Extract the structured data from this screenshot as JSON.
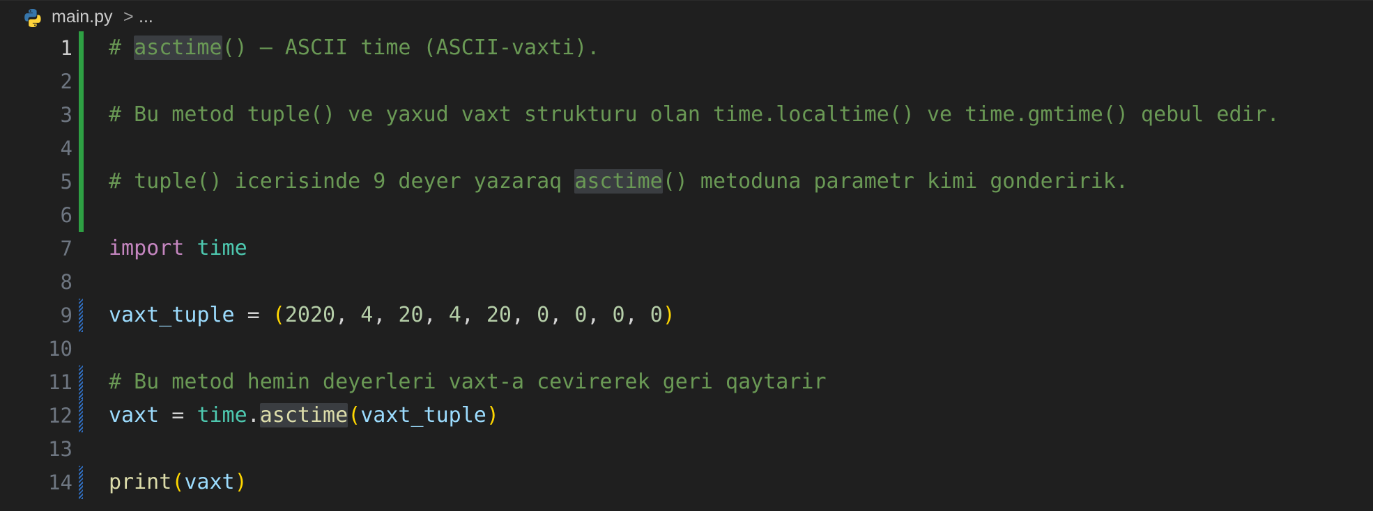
{
  "breadcrumb": {
    "file": "main.py",
    "separator": ">",
    "more": "..."
  },
  "icons": {
    "file_icon": "python-icon",
    "colors": {
      "python_blue": "#3776ab",
      "python_yellow": "#ffd43b"
    }
  },
  "gutter_colors": {
    "added": "#2ea043",
    "modified": "#2f6ec0"
  },
  "lines": [
    {
      "num": "1",
      "active": true,
      "tokens": [
        {
          "t": "# ",
          "c": "cmt"
        },
        {
          "t": "asctime",
          "c": "cmt hl"
        },
        {
          "t": "() – ASCII time (ASCII-vaxti).",
          "c": "cmt"
        }
      ]
    },
    {
      "num": "2",
      "tokens": []
    },
    {
      "num": "3",
      "tokens": [
        {
          "t": "# Bu metod tuple() ve yaxud vaxt strukturu olan time.localtime() ve time.gmtime() qebul edir.",
          "c": "cmt"
        }
      ]
    },
    {
      "num": "4",
      "tokens": []
    },
    {
      "num": "5",
      "tokens": [
        {
          "t": "# tuple() icerisinde 9 deyer yazaraq ",
          "c": "cmt"
        },
        {
          "t": "asctime",
          "c": "cmt hl"
        },
        {
          "t": "() metoduna parametr kimi gonderirik.",
          "c": "cmt"
        }
      ]
    },
    {
      "num": "6",
      "tokens": []
    },
    {
      "num": "7",
      "tokens": [
        {
          "t": "import",
          "c": "kw"
        },
        {
          "t": " ",
          "c": "op"
        },
        {
          "t": "time",
          "c": "mod"
        }
      ]
    },
    {
      "num": "8",
      "tokens": []
    },
    {
      "num": "9",
      "tokens": [
        {
          "t": "vaxt_tuple",
          "c": "var"
        },
        {
          "t": " = ",
          "c": "op"
        },
        {
          "t": "(",
          "c": "paren"
        },
        {
          "t": "2020",
          "c": "num"
        },
        {
          "t": ", ",
          "c": "op"
        },
        {
          "t": "4",
          "c": "num"
        },
        {
          "t": ", ",
          "c": "op"
        },
        {
          "t": "20",
          "c": "num"
        },
        {
          "t": ", ",
          "c": "op"
        },
        {
          "t": "4",
          "c": "num"
        },
        {
          "t": ", ",
          "c": "op"
        },
        {
          "t": "20",
          "c": "num"
        },
        {
          "t": ", ",
          "c": "op"
        },
        {
          "t": "0",
          "c": "num"
        },
        {
          "t": ", ",
          "c": "op"
        },
        {
          "t": "0",
          "c": "num"
        },
        {
          "t": ", ",
          "c": "op"
        },
        {
          "t": "0",
          "c": "num"
        },
        {
          "t": ", ",
          "c": "op"
        },
        {
          "t": "0",
          "c": "num"
        },
        {
          "t": ")",
          "c": "paren"
        }
      ]
    },
    {
      "num": "10",
      "tokens": []
    },
    {
      "num": "11",
      "tokens": [
        {
          "t": "# Bu metod hemin deyerleri vaxt-a cevirerek geri qaytarir",
          "c": "cmt"
        }
      ]
    },
    {
      "num": "12",
      "tokens": [
        {
          "t": "vaxt",
          "c": "var"
        },
        {
          "t": " = ",
          "c": "op"
        },
        {
          "t": "time",
          "c": "mod"
        },
        {
          "t": ".",
          "c": "op"
        },
        {
          "t": "asctime",
          "c": "fn hl"
        },
        {
          "t": "(",
          "c": "paren"
        },
        {
          "t": "vaxt_tuple",
          "c": "var"
        },
        {
          "t": ")",
          "c": "paren"
        }
      ]
    },
    {
      "num": "13",
      "tokens": []
    },
    {
      "num": "14",
      "tokens": [
        {
          "t": "print",
          "c": "fn"
        },
        {
          "t": "(",
          "c": "paren"
        },
        {
          "t": "vaxt",
          "c": "var"
        },
        {
          "t": ")",
          "c": "paren"
        }
      ]
    }
  ]
}
